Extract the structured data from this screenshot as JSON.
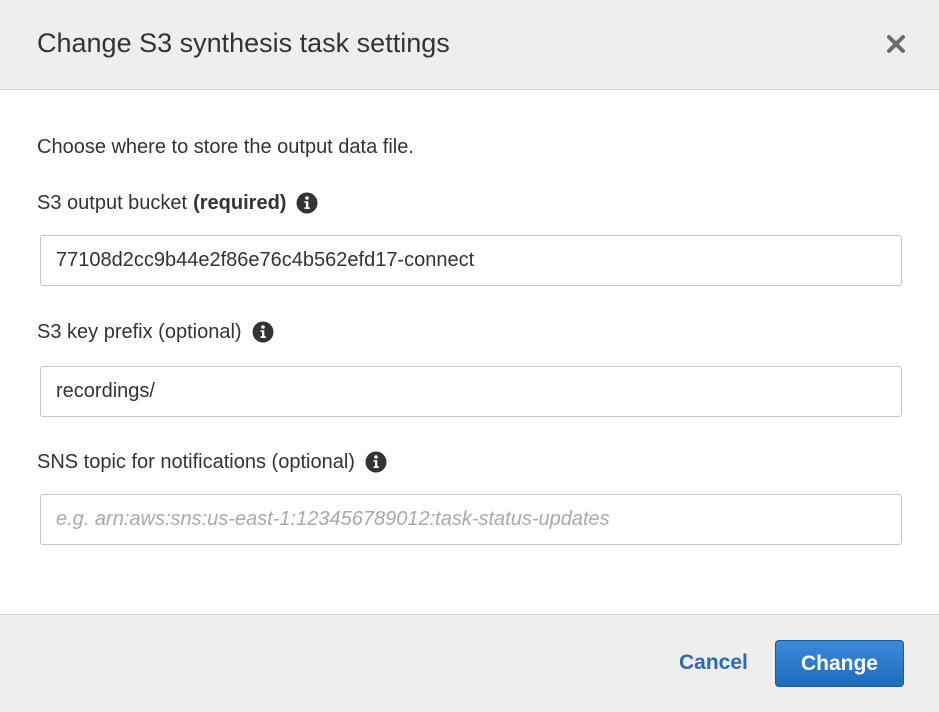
{
  "dialog": {
    "title": "Change S3 synthesis task settings",
    "close_icon": "close-icon"
  },
  "body": {
    "intro": "Choose where to store the output data file.",
    "fields": [
      {
        "label": "S3 output bucket",
        "label_suffix": "(required)",
        "info_icon": "info-icon",
        "value": "77108d2cc9b44e2f86e76c4b562efd17-connect",
        "placeholder": ""
      },
      {
        "label": "S3 key prefix (optional)",
        "info_icon": "info-icon",
        "value": "recordings/",
        "placeholder": ""
      },
      {
        "label": "SNS topic for notifications (optional)",
        "info_icon": "info-icon",
        "value": "",
        "placeholder": "e.g. arn:aws:sns:us-east-1:123456789012:task-status-updates"
      }
    ]
  },
  "footer": {
    "cancel_label": "Cancel",
    "submit_label": "Change"
  },
  "colors": {
    "header_bg": "#eeeeee",
    "link": "#2a6ab5",
    "primary": "#1f6bbf",
    "text": "#333333"
  }
}
